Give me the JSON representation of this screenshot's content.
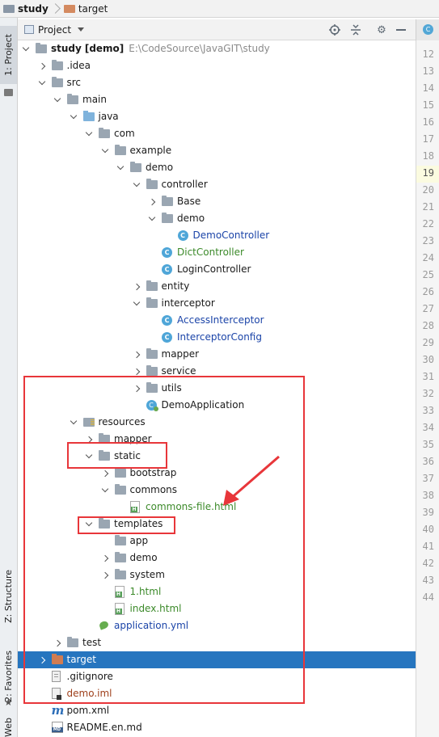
{
  "breadcrumbs": [
    {
      "label": "study",
      "color": "#8a97a6"
    },
    {
      "label": "target",
      "color": "#d48a60"
    }
  ],
  "panel": {
    "title": "Project",
    "icons": [
      "crosshair-icon",
      "collapse-all-icon",
      "gear-icon",
      "hide-icon"
    ]
  },
  "side_tabs": {
    "project": "1: Project",
    "structure": "Z: Structure",
    "favorites": "2: Favorites",
    "web": "Web"
  },
  "editor": {
    "tab_icon": "class-icon"
  },
  "gutter_lines": [
    "12",
    "13",
    "14",
    "15",
    "16",
    "17",
    "18",
    "19",
    "20",
    "21",
    "22",
    "23",
    "24",
    "25",
    "26",
    "27",
    "28",
    "29",
    "30",
    "31",
    "32",
    "33",
    "34",
    "35",
    "36",
    "37",
    "38",
    "39",
    "40",
    "41",
    "42",
    "43",
    "44"
  ],
  "current_line": "19",
  "tree": [
    {
      "label": "study",
      "bold": true,
      "path": "E:\\CodeSource\\JavaGIT\\study",
      "bracket": "[demo]",
      "depth": 0,
      "arrow": "exp",
      "icon": "folder"
    },
    {
      "label": ".idea",
      "depth": 1,
      "arrow": "col",
      "icon": "folder"
    },
    {
      "label": "src",
      "depth": 1,
      "arrow": "exp",
      "icon": "folder"
    },
    {
      "label": "main",
      "depth": 2,
      "arrow": "exp",
      "icon": "folder"
    },
    {
      "label": "java",
      "depth": 3,
      "arrow": "exp",
      "icon": "folder-blue"
    },
    {
      "label": "com",
      "depth": 4,
      "arrow": "exp",
      "icon": "folder"
    },
    {
      "label": "example",
      "depth": 5,
      "arrow": "exp",
      "icon": "folder"
    },
    {
      "label": "demo",
      "depth": 6,
      "arrow": "exp",
      "icon": "folder"
    },
    {
      "label": "controller",
      "depth": 7,
      "arrow": "exp",
      "icon": "folder"
    },
    {
      "label": "Base",
      "depth": 8,
      "arrow": "col",
      "icon": "folder"
    },
    {
      "label": "demo",
      "depth": 8,
      "arrow": "exp",
      "icon": "folder"
    },
    {
      "label": "DemoController",
      "depth": 9,
      "arrow": "none",
      "icon": "cls",
      "color": "blue"
    },
    {
      "label": "DictController",
      "depth": 8,
      "arrow": "none",
      "icon": "cls",
      "color": "green"
    },
    {
      "label": "LoginController",
      "depth": 8,
      "arrow": "none",
      "icon": "cls",
      "color": "default"
    },
    {
      "label": "entity",
      "depth": 7,
      "arrow": "col",
      "icon": "folder"
    },
    {
      "label": "interceptor",
      "depth": 7,
      "arrow": "exp",
      "icon": "folder"
    },
    {
      "label": "AccessInterceptor",
      "depth": 8,
      "arrow": "none",
      "icon": "cls",
      "color": "blue"
    },
    {
      "label": "InterceptorConfig",
      "depth": 8,
      "arrow": "none",
      "icon": "cls",
      "color": "blue"
    },
    {
      "label": "mapper",
      "depth": 7,
      "arrow": "col",
      "icon": "folder"
    },
    {
      "label": "service",
      "depth": 7,
      "arrow": "col",
      "icon": "folder"
    },
    {
      "label": "utils",
      "depth": 7,
      "arrow": "col",
      "icon": "folder"
    },
    {
      "label": "DemoApplication",
      "depth": 7,
      "arrow": "none",
      "icon": "spring",
      "color": "default"
    },
    {
      "label": "resources",
      "depth": 3,
      "arrow": "exp",
      "icon": "folder-res"
    },
    {
      "label": "mapper",
      "depth": 4,
      "arrow": "col",
      "icon": "folder"
    },
    {
      "label": "static",
      "depth": 4,
      "arrow": "exp",
      "icon": "folder"
    },
    {
      "label": "bootstrap",
      "depth": 5,
      "arrow": "col",
      "icon": "folder"
    },
    {
      "label": "commons",
      "depth": 5,
      "arrow": "exp",
      "icon": "folder"
    },
    {
      "label": "commons-file.html",
      "depth": 6,
      "arrow": "none",
      "icon": "html",
      "color": "green"
    },
    {
      "label": "templates",
      "depth": 4,
      "arrow": "exp",
      "icon": "folder"
    },
    {
      "label": "app",
      "depth": 5,
      "arrow": "none",
      "icon": "folder"
    },
    {
      "label": "demo",
      "depth": 5,
      "arrow": "col",
      "icon": "folder"
    },
    {
      "label": "system",
      "depth": 5,
      "arrow": "col",
      "icon": "folder"
    },
    {
      "label": "1.html",
      "depth": 5,
      "arrow": "none",
      "icon": "html",
      "color": "green"
    },
    {
      "label": "index.html",
      "depth": 5,
      "arrow": "none",
      "icon": "html",
      "color": "green"
    },
    {
      "label": "application.yml",
      "depth": 4,
      "arrow": "none",
      "icon": "yml",
      "color": "blue"
    },
    {
      "label": "test",
      "depth": 2,
      "arrow": "col",
      "icon": "folder"
    },
    {
      "label": "target",
      "depth": 1,
      "arrow": "col",
      "icon": "folder-orange",
      "selected": true
    },
    {
      "label": ".gitignore",
      "depth": 1,
      "arrow": "none",
      "icon": "file",
      "color": "default"
    },
    {
      "label": "demo.iml",
      "depth": 1,
      "arrow": "none",
      "icon": "iml",
      "color": "brown"
    },
    {
      "label": "pom.xml",
      "depth": 1,
      "arrow": "none",
      "icon": "maven",
      "color": "default"
    },
    {
      "label": "README.en.md",
      "depth": 1,
      "arrow": "none",
      "icon": "md",
      "color": "default"
    }
  ],
  "colors": {
    "selection": "#2675bf",
    "annotation": "#e8363a"
  }
}
